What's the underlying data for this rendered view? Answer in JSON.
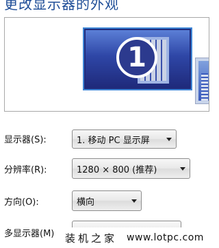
{
  "page": {
    "title": "更改显示器的外观"
  },
  "preview": {
    "monitor_1_number": "1"
  },
  "settings": {
    "display": {
      "label": "显示器(S):",
      "value": "1. 移动 PC 显示屏"
    },
    "resolution": {
      "label": "分辨率(R):",
      "value": "1280 × 800 (推荐)"
    },
    "orientation": {
      "label": "方向(O):",
      "value": "横向"
    },
    "multiple_displays": {
      "label": "多显示器(M)"
    }
  },
  "watermark": {
    "site_name": "装机之家",
    "url": "www.lotpc.com"
  },
  "colors": {
    "title": "#1e4d97",
    "selected_monitor_border": "#3e86d6",
    "monitor_screen": "#1f2a7b"
  },
  "icons": {
    "dropdown_caret": "chevron-down-icon"
  }
}
